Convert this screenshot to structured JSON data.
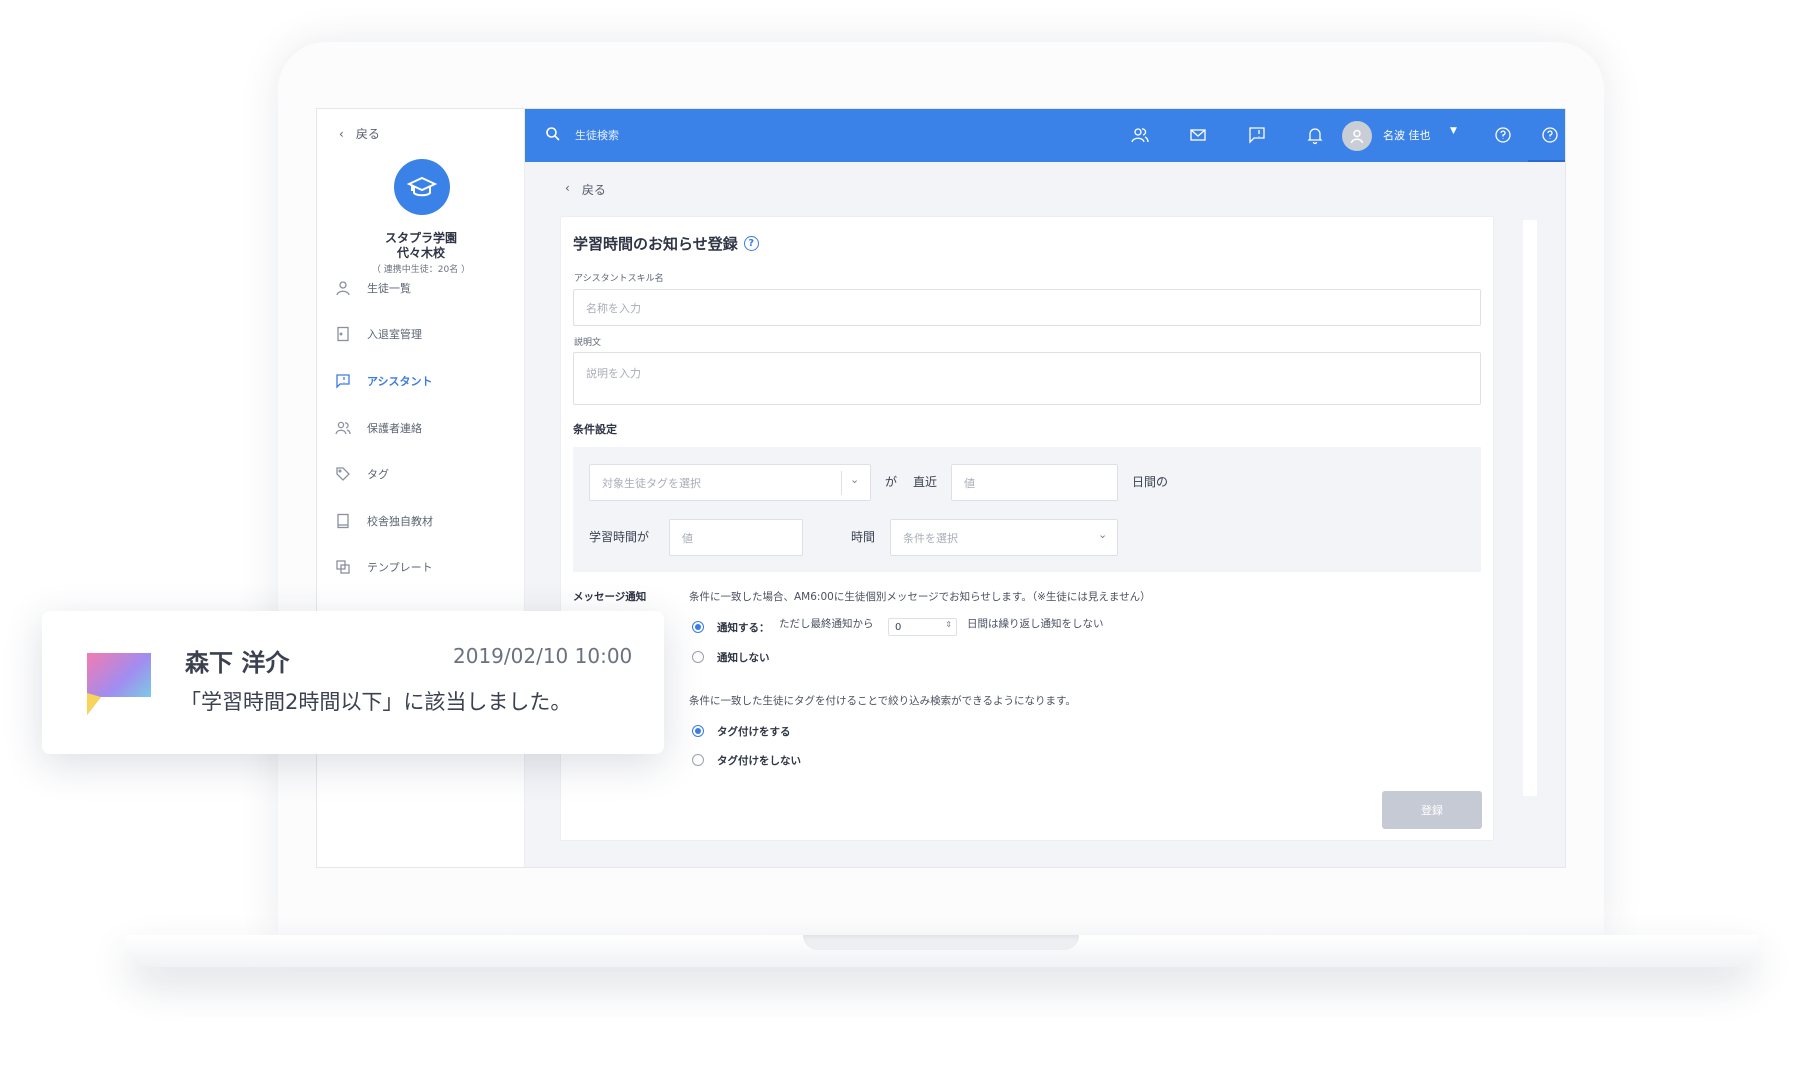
{
  "sidebar": {
    "back_label": "戻る",
    "school_name_line1": "スタプラ学園",
    "school_name_line2": "代々木校",
    "school_sub": "（ 連携中生徒：20名 ）",
    "items": [
      {
        "label": "生徒一覧",
        "icon": "person-icon"
      },
      {
        "label": "入退室管理",
        "icon": "door-icon"
      },
      {
        "label": "アシスタント",
        "icon": "chat-flag-icon",
        "active": true
      },
      {
        "label": "保護者連絡",
        "icon": "people-icon"
      },
      {
        "label": "タグ",
        "icon": "tag-icon"
      },
      {
        "label": "校舎独自教材",
        "icon": "book-icon"
      },
      {
        "label": "テンプレート",
        "icon": "copy-icon"
      }
    ]
  },
  "topbar": {
    "search_placeholder": "生徒検索",
    "user_name": "名波 佳也",
    "accent_color": "#3b82e8"
  },
  "main": {
    "back_label": "戻る",
    "form_title": "学習時間のお知らせ登録",
    "skill_name_label": "アシスタントスキル名",
    "skill_name_placeholder": "名称を入力",
    "description_label": "説明文",
    "description_placeholder": "説明を入力",
    "condition_title": "条件設定",
    "tag_select_placeholder": "対象生徒タグを選択",
    "ga": "が",
    "recent": "直近",
    "value_placeholder": "値",
    "days_of": "日間の",
    "study_time_ga": "学習時間が",
    "hours": "時間",
    "condition_select_placeholder": "条件を選択",
    "message_notify_label": "メッセージ通知",
    "message_notify_desc": "条件に一致した場合、AM6:00に生徒個別メッセージでお知らせします。（※生徒には見えません）",
    "notify_on": "通知する：",
    "notify_on_suffix": "ただし最終通知から",
    "notify_days_value": "0",
    "notify_on_tail": "日間は繰り返し通知をしない",
    "notify_off": "通知しない",
    "tag_desc": "条件に一致した生徒にタグを付けることで絞り込み検索ができるようになります。",
    "tag_on": "タグ付けをする",
    "tag_off": "タグ付けをしない",
    "submit_label": "登録"
  },
  "notification": {
    "sender": "森下 洋介",
    "timestamp": "2019/02/10 10:00",
    "message": "「学習時間2時間以下」に該当しました。"
  }
}
